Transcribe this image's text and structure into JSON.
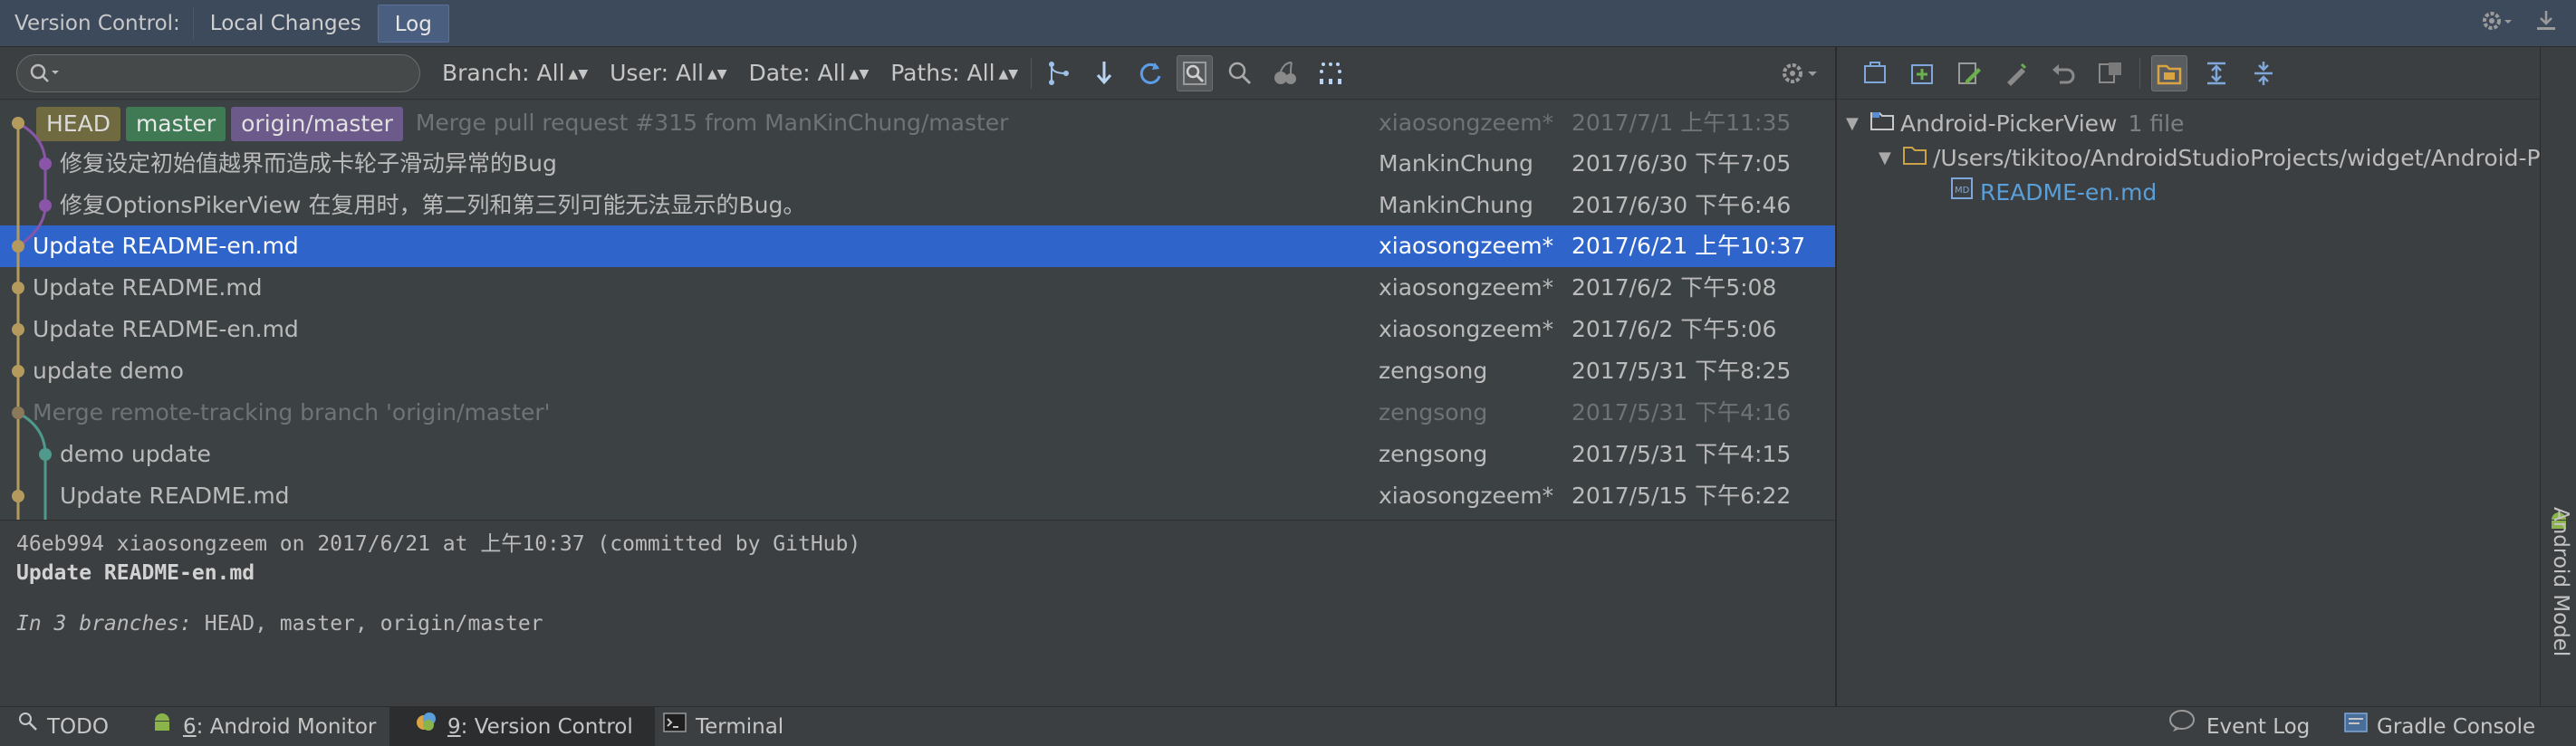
{
  "header": {
    "title": "Version Control:",
    "tabs": [
      {
        "label": "Local Changes"
      },
      {
        "label": "Log"
      }
    ]
  },
  "toolbar": {
    "search_placeholder": "",
    "filters": [
      {
        "label": "Branch: All"
      },
      {
        "label": "User: All"
      },
      {
        "label": "Date: All"
      },
      {
        "label": "Paths: All"
      }
    ],
    "icons": [
      "branch-graph-icon",
      "arrow-down-icon",
      "refresh-icon",
      "highlight-icon",
      "zoom-icon",
      "cherry-pick-icon",
      "intellisort-icon"
    ]
  },
  "commits": [
    {
      "refs": [
        "HEAD",
        "master",
        "origin/master"
      ],
      "subject": "Merge pull request #315 from ManKinChung/master",
      "author": "xiaosongzeem*",
      "date": "2017/7/1 上午11:35"
    },
    {
      "refs": [],
      "subject": "修复设定初始值越界而造成卡轮子滑动异常的Bug",
      "author": "MankinChung",
      "date": "2017/6/30 下午7:05"
    },
    {
      "refs": [],
      "subject": "修复OptionsPikerView 在复用时，第二列和第三列可能无法显示的Bug。",
      "author": "MankinChung",
      "date": "2017/6/30 下午6:46"
    },
    {
      "refs": [],
      "subject": "Update README-en.md",
      "author": "xiaosongzeem*",
      "date": "2017/6/21 上午10:37"
    },
    {
      "refs": [],
      "subject": "Update README.md",
      "author": "xiaosongzeem*",
      "date": "2017/6/2 下午5:08"
    },
    {
      "refs": [],
      "subject": "Update README-en.md",
      "author": "xiaosongzeem*",
      "date": "2017/6/2 下午5:06"
    },
    {
      "refs": [],
      "subject": "update demo",
      "author": "zengsong",
      "date": "2017/5/31 下午8:25"
    },
    {
      "refs": [],
      "subject": "Merge remote-tracking branch 'origin/master'",
      "author": "zengsong",
      "date": "2017/5/31 下午4:16"
    },
    {
      "refs": [],
      "subject": "demo update",
      "author": "zengsong",
      "date": "2017/5/31 下午4:15"
    },
    {
      "refs": [],
      "subject": "Update README.md",
      "author": "xiaosongzeem*",
      "date": "2017/5/15 下午6:22"
    }
  ],
  "details": {
    "line1": "46eb994 xiaosongzeem on 2017/6/21 at 上午10:37 (committed by GitHub)",
    "line2": "Update README-en.md",
    "branches_prefix": "In 3 branches:",
    "branches_value": " HEAD, master, origin/master"
  },
  "tree": {
    "root_label": "Android-PickerView",
    "root_count": "1 file",
    "path_label": "/Users/tikitoo/AndroidStudioProjects/widget/Android-Pic",
    "file_label": "README-en.md"
  },
  "side_stripe": {
    "label": "Android Model"
  },
  "bottom_bar": {
    "todo": "TODO",
    "android_monitor_num": "6",
    "android_monitor": ": Android Monitor",
    "version_control_num": "9",
    "version_control": ": Version Control",
    "terminal": "Terminal",
    "event_log": "Event Log",
    "gradle_console": "Gradle Console"
  },
  "colors": {
    "selection": "#2f65ca",
    "head_ref": "#6f6a3f",
    "master_ref": "#3f7a55",
    "origin_ref": "#6b5a8a",
    "link": "#5a9fd8"
  }
}
